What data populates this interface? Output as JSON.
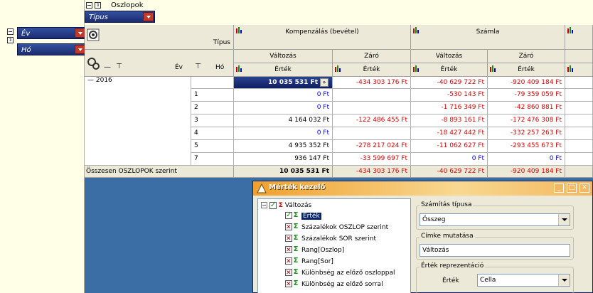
{
  "filter": {
    "oszlopok_label": "Oszlopok",
    "tipus_chip": "Típus",
    "ev_chip": "Év",
    "ho_chip": "Hó"
  },
  "grid": {
    "tipus_header": "Típus",
    "ev_header": "Év",
    "ho_header": "Hó",
    "group1": "Kompenzálás (bevétel)",
    "group2": "Számla",
    "sub_valtozas": "Változás",
    "sub_zaro": "Záró",
    "ertek": "Érték",
    "year": "2016",
    "rows": [
      {
        "ho": "1",
        "c1": "0 Ft",
        "c2": "",
        "c3": "-530 143 Ft",
        "c4": "-79 359 059 Ft"
      },
      {
        "ho": "2",
        "c1": "0 Ft",
        "c2": "",
        "c3": "-1 716 349 Ft",
        "c4": "-42 860 881 Ft"
      },
      {
        "ho": "3",
        "c1": "4 164 032 Ft",
        "c2": "-122 486 455 Ft",
        "c3": "-8 893 161 Ft",
        "c4": "-172 476 308 Ft"
      },
      {
        "ho": "4",
        "c1": "0 Ft",
        "c2": "",
        "c3": "-18 427 442 Ft",
        "c4": "-332 257 263 Ft"
      },
      {
        "ho": "5",
        "c1": "4 935 352 Ft",
        "c2": "-278 217 024 Ft",
        "c3": "-11 062 627 Ft",
        "c4": "-293 455 673 Ft"
      },
      {
        "ho": "7",
        "c1": "936 147 Ft",
        "c2": "-33 599 697 Ft",
        "c3": "0 Ft",
        "c4": "0 Ft"
      }
    ],
    "year_row": {
      "c1": "10 035 531 Ft",
      "c2": "-434 303 176 Ft",
      "c3": "-40 629 722 Ft",
      "c4": "-920 409 184 Ft"
    },
    "total_label": "Összesen OSZLOPOK szerint",
    "total_row": {
      "c1": "10 035 531 Ft",
      "c2": "-434 303 176 Ft",
      "c3": "-40 629 722 Ft",
      "c4": "-920 409 184 Ft"
    }
  },
  "dialog": {
    "title": "Mérték kezelő",
    "tree_root": "Változás",
    "tree_items": [
      "Érték",
      "Százalékok OSZLOP szerint",
      "Százalékok SOR szerint",
      "Rang[Oszlop]",
      "Rang[Sor]",
      "Különbség az előző oszloppal",
      "Különbség az előző sorral"
    ],
    "szamitas_label": "Számítás típusa",
    "szamitas_value": "Összeg",
    "cimke_label": "Címke mutatása",
    "cimke_value": "Változás",
    "ertek_repr_label": "Érték reprezentáció",
    "ertek_label": "Érték",
    "ertek_value": "Cella"
  }
}
